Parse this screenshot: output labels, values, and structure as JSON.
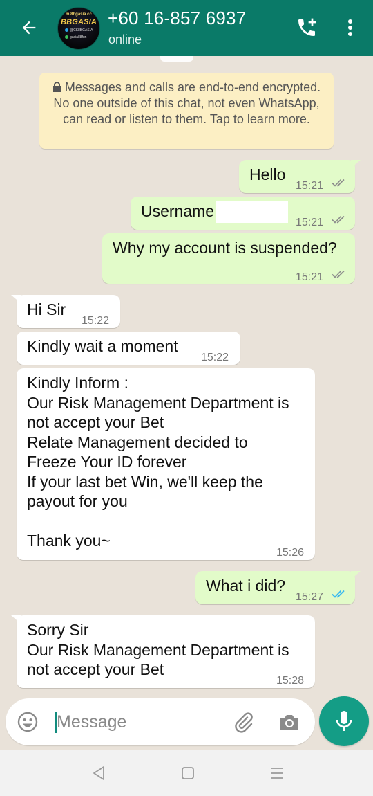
{
  "header": {
    "contact_name": "+60 16-857 6937",
    "status": "online",
    "avatar_text": {
      "line1": "m.8bgasia.cc",
      "line2": "BBGASIA",
      "line3": "@CS8BGASIA",
      "line4": "gasia88fun"
    }
  },
  "banner": {
    "encryption_notice": "Messages and calls are end-to-end encrypted. No one outside of this chat, not even WhatsApp, can read or listen to them. Tap to learn more."
  },
  "messages": [
    {
      "direction": "outgoing",
      "text": "Hello",
      "time": "15:21",
      "status": "delivered"
    },
    {
      "direction": "outgoing",
      "text": "Username",
      "time": "15:21",
      "status": "delivered"
    },
    {
      "direction": "outgoing",
      "text": "Why my account is suspended?",
      "time": "15:21",
      "status": "delivered"
    },
    {
      "direction": "incoming",
      "text": "Hi Sir",
      "time": "15:22"
    },
    {
      "direction": "incoming",
      "text": "Kindly wait a moment",
      "time": "15:22"
    },
    {
      "direction": "incoming",
      "text": "Kindly Inform :\nOur Risk Management Department is\nnot accept your Bet\nRelate Management decided to\nFreeze Your ID forever\nIf your last bet Win, we'll keep the\npayout for you\n\nThank you~",
      "time": "15:26"
    },
    {
      "direction": "outgoing",
      "text": "What i did?",
      "time": "15:27",
      "status": "read"
    },
    {
      "direction": "incoming",
      "text": "Sorry Sir\nOur Risk Management Department is\nnot accept your Bet",
      "time": "15:28"
    }
  ],
  "composer": {
    "placeholder": "Message"
  },
  "icons": {
    "back": "arrow-left-icon",
    "add_call": "phone-plus-icon",
    "menu": "more-vert-icon",
    "emoji": "emoji-icon",
    "attach": "paperclip-icon",
    "camera": "camera-icon",
    "mic": "mic-icon"
  },
  "colors": {
    "header": "#0a7a68",
    "outgoing_bubble": "#e2fbc9",
    "incoming_bubble": "#ffffff",
    "chat_background": "#e9e2d9",
    "read_ticks": "#34b7f1",
    "delivered_ticks": "#8c8c8c",
    "fab": "#149d86"
  }
}
